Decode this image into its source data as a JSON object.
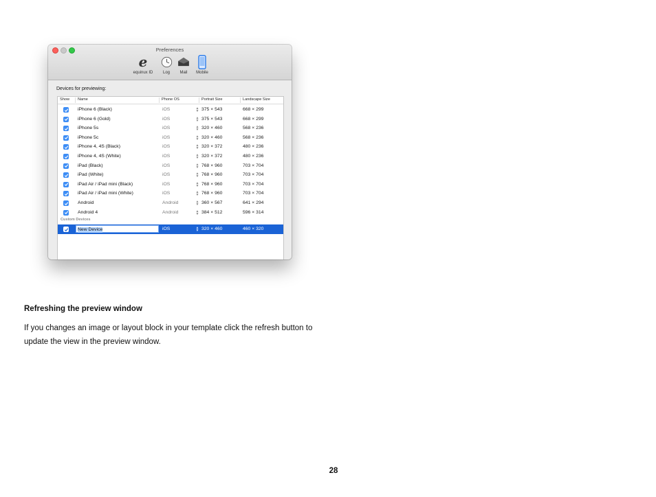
{
  "window": {
    "title": "Preferences",
    "toolbar": [
      {
        "label": "equinux ID",
        "icon": "equinux-e-icon"
      },
      {
        "label": "Log",
        "icon": "clock-icon"
      },
      {
        "label": "Mail",
        "icon": "mail-icon"
      },
      {
        "label": "Mobile",
        "icon": "phone-icon"
      }
    ],
    "section_label": "Devices for previewing:",
    "columns": {
      "show": "Show",
      "name": "Name",
      "os": "Phone OS",
      "portrait": "Portrait Size",
      "landscape": "Landscape Size"
    },
    "devices": [
      {
        "name": "iPhone 6 (Black)",
        "os": "iOS",
        "portrait": "375 × 543",
        "landscape": "668 × 299",
        "show": true
      },
      {
        "name": "iPhone 6 (Gold)",
        "os": "iOS",
        "portrait": "375 × 543",
        "landscape": "668 × 299",
        "show": true
      },
      {
        "name": "iPhone 5s",
        "os": "iOS",
        "portrait": "320 × 460",
        "landscape": "568 × 236",
        "show": true
      },
      {
        "name": "iPhone 5c",
        "os": "iOS",
        "portrait": "320 × 460",
        "landscape": "568 × 236",
        "show": true
      },
      {
        "name": "iPhone 4, 4S (Black)",
        "os": "iOS",
        "portrait": "320 × 372",
        "landscape": "480 × 236",
        "show": true
      },
      {
        "name": "iPhone 4, 4S (White)",
        "os": "iOS",
        "portrait": "320 × 372",
        "landscape": "480 × 236",
        "show": true
      },
      {
        "name": "iPad (Black)",
        "os": "iOS",
        "portrait": "768 × 960",
        "landscape": "703 × 704",
        "show": true
      },
      {
        "name": "iPad (White)",
        "os": "iOS",
        "portrait": "768 × 960",
        "landscape": "703 × 704",
        "show": true
      },
      {
        "name": "iPad Air / iPad mini (Black)",
        "os": "iOS",
        "portrait": "768 × 960",
        "landscape": "703 × 704",
        "show": true
      },
      {
        "name": "iPad Air / iPad mini (White)",
        "os": "iOS",
        "portrait": "768 × 960",
        "landscape": "703 × 704",
        "show": true
      },
      {
        "name": "Android",
        "os": "Android",
        "portrait": "360 × 567",
        "landscape": "641 × 294",
        "show": true
      },
      {
        "name": "Android 4",
        "os": "Android",
        "portrait": "384 × 512",
        "landscape": "596 × 314",
        "show": true
      }
    ],
    "custom_label": "Custom Devices",
    "custom_device": {
      "name": "New Device",
      "os": "iOS",
      "portrait": "320 × 460",
      "landscape": "460 × 320",
      "show": true
    },
    "add_button": "+",
    "remove_button": "−",
    "colors": {
      "selection": "#1a63d6",
      "checkbox": "#3d8df5"
    }
  },
  "doc": {
    "heading": "Refreshing the preview window",
    "paragraph": "If you changes an image or layout block in your template click the refresh button to update the view in the preview window.",
    "page_number": "28"
  }
}
